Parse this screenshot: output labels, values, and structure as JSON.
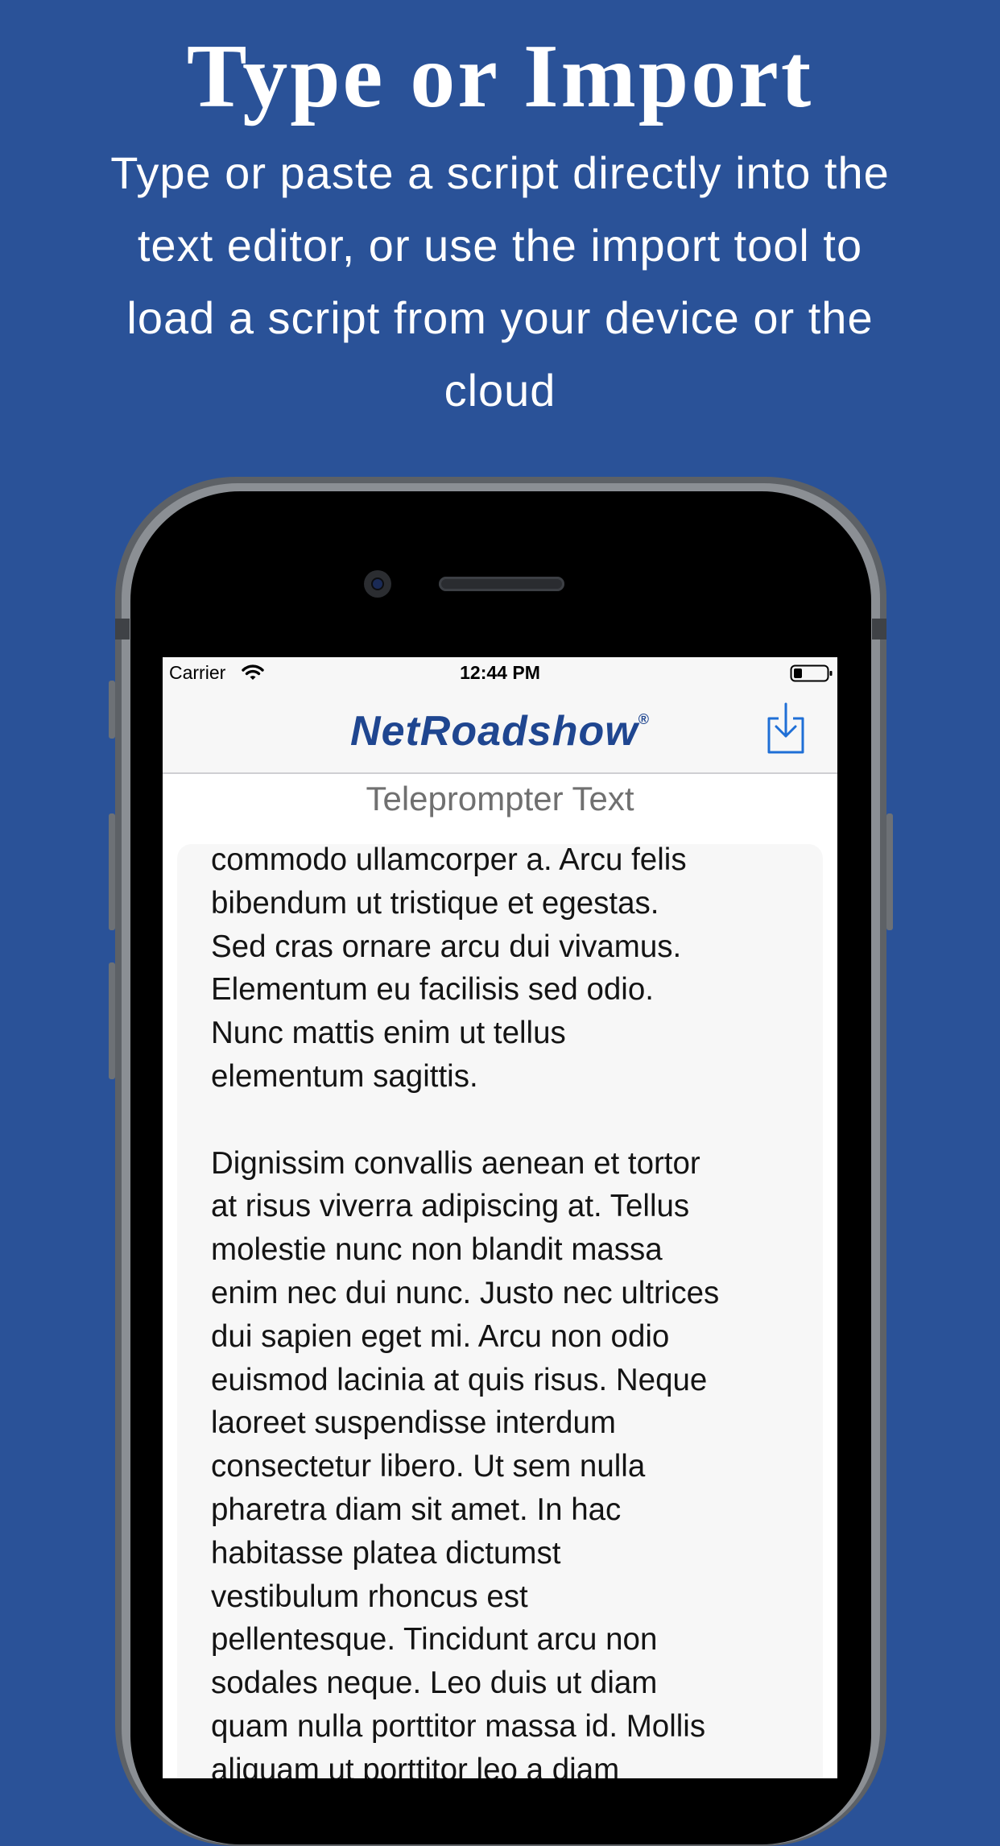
{
  "promo": {
    "headline": "Type or Import",
    "subhead": "Type or paste a script directly into the text editor, or use the import tool to load a script from your device or the cloud",
    "background_color": "#2a5298"
  },
  "status_bar": {
    "carrier": "Carrier",
    "time": "12:44 PM",
    "icons": [
      "wifi-icon",
      "battery-icon"
    ]
  },
  "nav_bar": {
    "logo_text": "NetRoadshow",
    "logo_mark": "®",
    "logo_color": "#1f4690",
    "import_icon": "import-download-icon"
  },
  "editor": {
    "title": "Teleprompter Text",
    "text": "commodo ullamcorper a. Arcu felis\nbibendum ut tristique et egestas.\nSed cras ornare arcu dui vivamus.\nElementum eu facilisis sed odio.\nNunc mattis enim ut tellus\nelementum sagittis.\n\nDignissim convallis aenean et tortor\nat risus viverra adipiscing at. Tellus\nmolestie nunc non blandit massa\nenim nec dui nunc. Justo nec ultrices\ndui sapien eget mi. Arcu non odio\neuismod lacinia at quis risus. Neque\nlaoreet suspendisse interdum\nconsectetur libero. Ut sem nulla\npharetra diam sit amet. In hac\nhabitasse platea dictumst\nvestibulum rhoncus est\npellentesque. Tincidunt arcu non\nsodales neque. Leo duis ut diam\nquam nulla porttitor massa id. Mollis\naliquam ut porttitor leo a diam"
  }
}
